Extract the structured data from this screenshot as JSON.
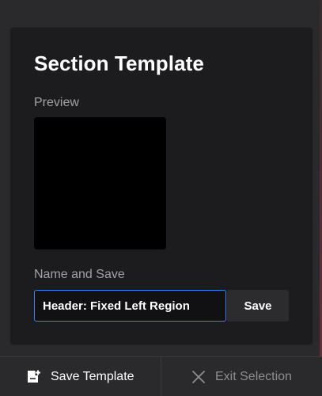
{
  "panel": {
    "title": "Section Template",
    "preview_label": "Preview",
    "name_label": "Name and Save",
    "name_input": {
      "value": "Header: Fixed Left Region",
      "placeholder": ""
    },
    "save_label": "Save"
  },
  "bottom_bar": {
    "save_template_label": "Save Template",
    "save_template_icon": "document-add-icon",
    "exit_selection_label": "Exit Selection",
    "exit_selection_icon": "close-icon"
  },
  "colors": {
    "panel_background": "#1c1c1e",
    "preview_background": "#000000",
    "input_focus_border": "#3b82f6",
    "muted_text": "#a1a1a6",
    "disabled_text": "#8e8e93"
  }
}
